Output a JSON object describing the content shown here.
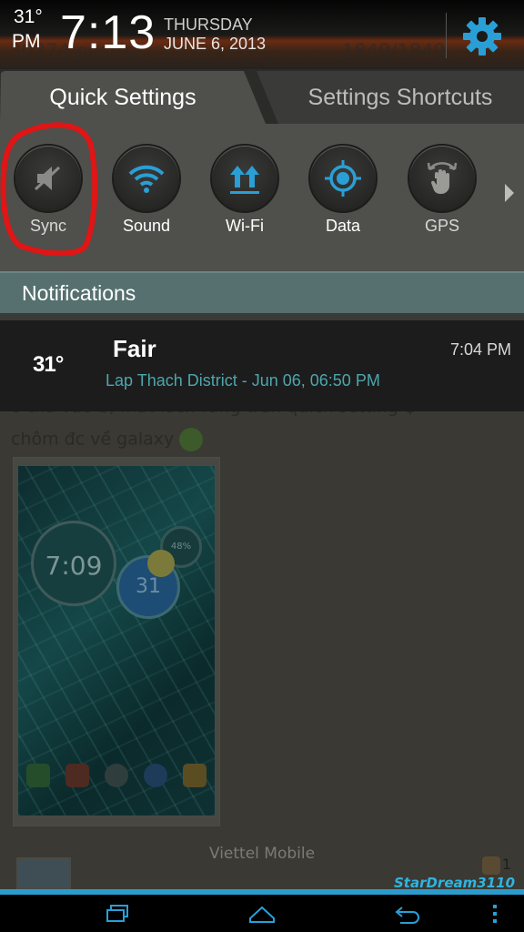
{
  "background": {
    "post_text_line1": "ố thứ vào b, mất locn ràng trên quick setting ♀",
    "post_text_line2": "chôm đc về galaxy",
    "ghost_left": "30374 post(s)",
    "ghost_right": "1849/1849",
    "phone_screenshot": {
      "clock": "7:09",
      "weather_temp": "31",
      "battery": "48%"
    },
    "carrier": "Viettel Mobile",
    "like_count": "1",
    "watermark": "StarDream3110"
  },
  "header": {
    "temperature": "31°",
    "ampm": "PM",
    "time": "7:13",
    "day": "THURSDAY",
    "date": "JUNE 6, 2013",
    "settings_icon": "gear-icon",
    "accent_color": "#2a9fd6"
  },
  "tabs": [
    {
      "label": "Quick Settings",
      "active": true
    },
    {
      "label": "Settings Shortcuts",
      "active": false
    }
  ],
  "quick_settings": [
    {
      "label": "Sync",
      "icon": "sound-muted-icon"
    },
    {
      "label": "Sound",
      "icon": "wifi-icon"
    },
    {
      "label": "Wi-Fi",
      "icon": "data-arrows-icon"
    },
    {
      "label": "Data",
      "icon": "gps-target-icon"
    },
    {
      "label": "GPS",
      "icon": "rotate-hand-icon"
    }
  ],
  "notifications_header": "Notifications",
  "notification": {
    "icon_text": "31°",
    "title": "Fair",
    "time": "7:04 PM",
    "subtitle": "Lap Thach District - Jun 06, 06:50 PM"
  },
  "navbar": {
    "recent": "recent-apps-icon",
    "home": "home-icon",
    "back": "back-icon",
    "menu": "overflow-menu-icon"
  }
}
